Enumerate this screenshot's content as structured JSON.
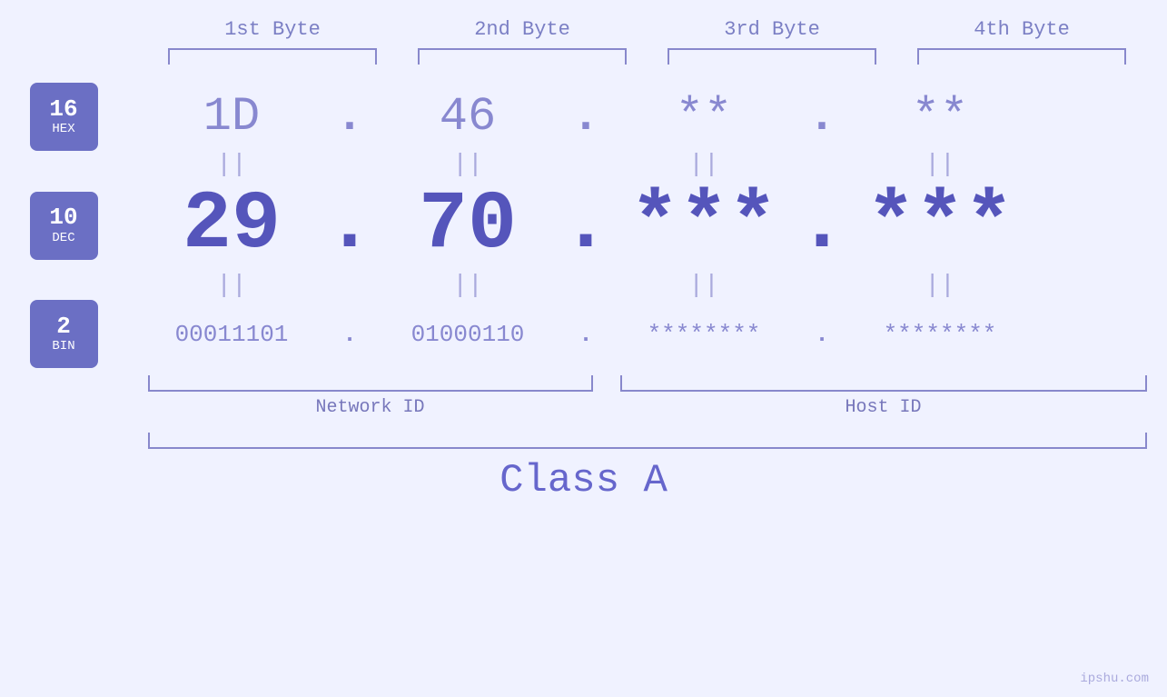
{
  "header": {
    "byte1": "1st Byte",
    "byte2": "2nd Byte",
    "byte3": "3rd Byte",
    "byte4": "4th Byte"
  },
  "badges": {
    "hex": {
      "number": "16",
      "label": "HEX"
    },
    "dec": {
      "number": "10",
      "label": "DEC"
    },
    "bin": {
      "number": "2",
      "label": "BIN"
    }
  },
  "hex_values": {
    "b1": "1D",
    "b2": "46",
    "b3": "**",
    "b4": "**",
    "d1": ".",
    "d2": ".",
    "d3": ".",
    "dots": [
      ".",
      ".",
      ".",
      ""
    ]
  },
  "dec_values": {
    "b1": "29",
    "b2": "70",
    "b3": "***",
    "b4": "***"
  },
  "bin_values": {
    "b1": "00011101",
    "b2": "01000110",
    "b3": "********",
    "b4": "********"
  },
  "equals": "||",
  "labels": {
    "network_id": "Network ID",
    "host_id": "Host ID",
    "class": "Class A"
  },
  "watermark": "ipshu.com"
}
